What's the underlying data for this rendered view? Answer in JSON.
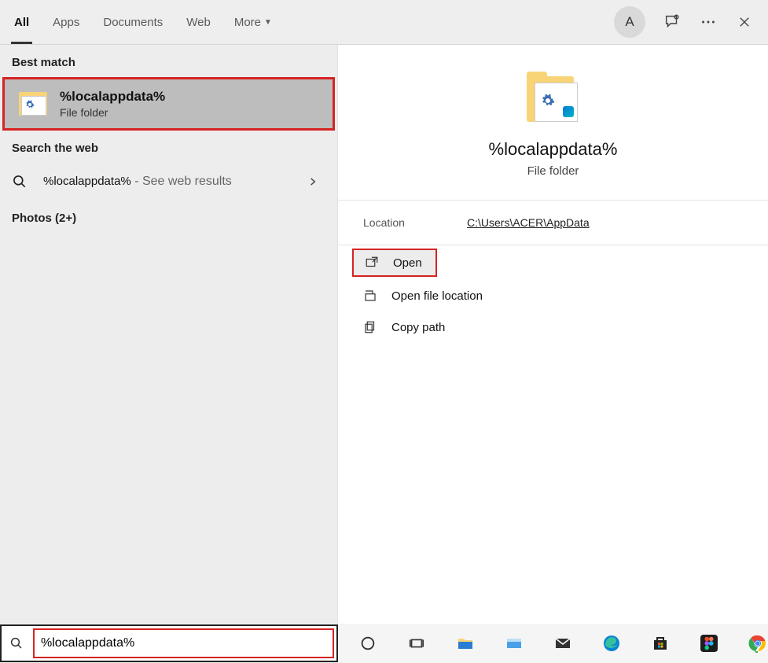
{
  "tabs": {
    "all": "All",
    "apps": "Apps",
    "documents": "Documents",
    "web": "Web",
    "more": "More"
  },
  "avatar_letter": "A",
  "sections": {
    "best_match": "Best match",
    "search_web": "Search the web",
    "photos": "Photos (2+)"
  },
  "best_match": {
    "title": "%localappdata%",
    "subtitle": "File folder"
  },
  "web_result": {
    "query": "%localappdata%",
    "suffix": " - See web results"
  },
  "preview": {
    "title": "%localappdata%",
    "subtitle": "File folder"
  },
  "info": {
    "location_label": "Location",
    "location_value": "C:\\Users\\ACER\\AppData"
  },
  "actions": {
    "open": "Open",
    "open_location": "Open file location",
    "copy_path": "Copy path"
  },
  "search_input": "%localappdata%"
}
